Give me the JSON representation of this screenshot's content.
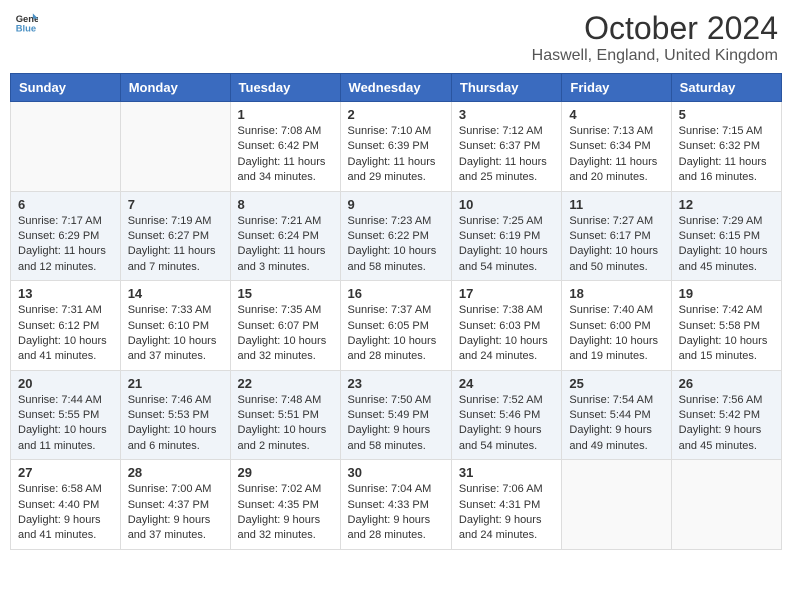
{
  "header": {
    "logo": {
      "line1": "General",
      "line2": "Blue"
    },
    "title": "October 2024",
    "subtitle": "Haswell, England, United Kingdom"
  },
  "days_of_week": [
    "Sunday",
    "Monday",
    "Tuesday",
    "Wednesday",
    "Thursday",
    "Friday",
    "Saturday"
  ],
  "weeks": [
    [
      {
        "day": "",
        "info": ""
      },
      {
        "day": "",
        "info": ""
      },
      {
        "day": "1",
        "info": "Sunrise: 7:08 AM\nSunset: 6:42 PM\nDaylight: 11 hours and 34 minutes."
      },
      {
        "day": "2",
        "info": "Sunrise: 7:10 AM\nSunset: 6:39 PM\nDaylight: 11 hours and 29 minutes."
      },
      {
        "day": "3",
        "info": "Sunrise: 7:12 AM\nSunset: 6:37 PM\nDaylight: 11 hours and 25 minutes."
      },
      {
        "day": "4",
        "info": "Sunrise: 7:13 AM\nSunset: 6:34 PM\nDaylight: 11 hours and 20 minutes."
      },
      {
        "day": "5",
        "info": "Sunrise: 7:15 AM\nSunset: 6:32 PM\nDaylight: 11 hours and 16 minutes."
      }
    ],
    [
      {
        "day": "6",
        "info": "Sunrise: 7:17 AM\nSunset: 6:29 PM\nDaylight: 11 hours and 12 minutes."
      },
      {
        "day": "7",
        "info": "Sunrise: 7:19 AM\nSunset: 6:27 PM\nDaylight: 11 hours and 7 minutes."
      },
      {
        "day": "8",
        "info": "Sunrise: 7:21 AM\nSunset: 6:24 PM\nDaylight: 11 hours and 3 minutes."
      },
      {
        "day": "9",
        "info": "Sunrise: 7:23 AM\nSunset: 6:22 PM\nDaylight: 10 hours and 58 minutes."
      },
      {
        "day": "10",
        "info": "Sunrise: 7:25 AM\nSunset: 6:19 PM\nDaylight: 10 hours and 54 minutes."
      },
      {
        "day": "11",
        "info": "Sunrise: 7:27 AM\nSunset: 6:17 PM\nDaylight: 10 hours and 50 minutes."
      },
      {
        "day": "12",
        "info": "Sunrise: 7:29 AM\nSunset: 6:15 PM\nDaylight: 10 hours and 45 minutes."
      }
    ],
    [
      {
        "day": "13",
        "info": "Sunrise: 7:31 AM\nSunset: 6:12 PM\nDaylight: 10 hours and 41 minutes."
      },
      {
        "day": "14",
        "info": "Sunrise: 7:33 AM\nSunset: 6:10 PM\nDaylight: 10 hours and 37 minutes."
      },
      {
        "day": "15",
        "info": "Sunrise: 7:35 AM\nSunset: 6:07 PM\nDaylight: 10 hours and 32 minutes."
      },
      {
        "day": "16",
        "info": "Sunrise: 7:37 AM\nSunset: 6:05 PM\nDaylight: 10 hours and 28 minutes."
      },
      {
        "day": "17",
        "info": "Sunrise: 7:38 AM\nSunset: 6:03 PM\nDaylight: 10 hours and 24 minutes."
      },
      {
        "day": "18",
        "info": "Sunrise: 7:40 AM\nSunset: 6:00 PM\nDaylight: 10 hours and 19 minutes."
      },
      {
        "day": "19",
        "info": "Sunrise: 7:42 AM\nSunset: 5:58 PM\nDaylight: 10 hours and 15 minutes."
      }
    ],
    [
      {
        "day": "20",
        "info": "Sunrise: 7:44 AM\nSunset: 5:55 PM\nDaylight: 10 hours and 11 minutes."
      },
      {
        "day": "21",
        "info": "Sunrise: 7:46 AM\nSunset: 5:53 PM\nDaylight: 10 hours and 6 minutes."
      },
      {
        "day": "22",
        "info": "Sunrise: 7:48 AM\nSunset: 5:51 PM\nDaylight: 10 hours and 2 minutes."
      },
      {
        "day": "23",
        "info": "Sunrise: 7:50 AM\nSunset: 5:49 PM\nDaylight: 9 hours and 58 minutes."
      },
      {
        "day": "24",
        "info": "Sunrise: 7:52 AM\nSunset: 5:46 PM\nDaylight: 9 hours and 54 minutes."
      },
      {
        "day": "25",
        "info": "Sunrise: 7:54 AM\nSunset: 5:44 PM\nDaylight: 9 hours and 49 minutes."
      },
      {
        "day": "26",
        "info": "Sunrise: 7:56 AM\nSunset: 5:42 PM\nDaylight: 9 hours and 45 minutes."
      }
    ],
    [
      {
        "day": "27",
        "info": "Sunrise: 6:58 AM\nSunset: 4:40 PM\nDaylight: 9 hours and 41 minutes."
      },
      {
        "day": "28",
        "info": "Sunrise: 7:00 AM\nSunset: 4:37 PM\nDaylight: 9 hours and 37 minutes."
      },
      {
        "day": "29",
        "info": "Sunrise: 7:02 AM\nSunset: 4:35 PM\nDaylight: 9 hours and 32 minutes."
      },
      {
        "day": "30",
        "info": "Sunrise: 7:04 AM\nSunset: 4:33 PM\nDaylight: 9 hours and 28 minutes."
      },
      {
        "day": "31",
        "info": "Sunrise: 7:06 AM\nSunset: 4:31 PM\nDaylight: 9 hours and 24 minutes."
      },
      {
        "day": "",
        "info": ""
      },
      {
        "day": "",
        "info": ""
      }
    ]
  ]
}
